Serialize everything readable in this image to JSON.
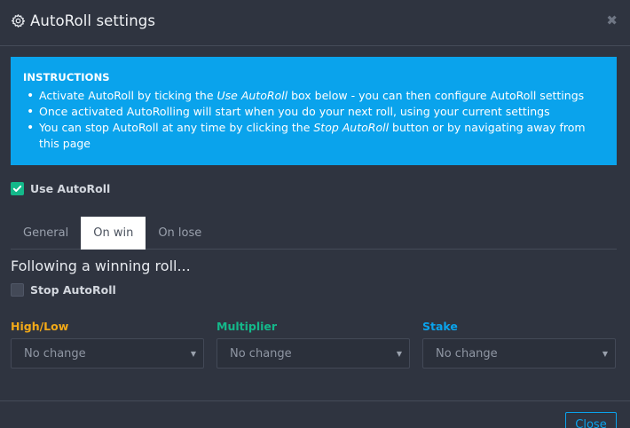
{
  "header": {
    "title": "AutoRoll settings",
    "icon": "gear-icon",
    "close_icon": "close-icon"
  },
  "instructions": {
    "heading": "INSTRUCTIONS",
    "items": [
      {
        "before": "Activate AutoRoll by ticking the ",
        "em": "Use AutoRoll",
        "after": " box below - you can then configure AutoRoll settings"
      },
      {
        "before": "Once activated AutoRolling will start when you do your next roll, using your current settings",
        "em": "",
        "after": ""
      },
      {
        "before": "You can stop AutoRoll at any time by clicking the ",
        "em": "Stop AutoRoll",
        "after": " button or by navigating away from this page"
      }
    ],
    "color": "#0aa3ec"
  },
  "use_autoroll": {
    "label": "Use AutoRoll",
    "checked": true,
    "color": "#14b88a"
  },
  "tabs": [
    {
      "label": "General",
      "active": false
    },
    {
      "label": "On win",
      "active": true
    },
    {
      "label": "On lose",
      "active": false
    }
  ],
  "section": {
    "heading": "Following a winning roll...",
    "stop_autoroll": {
      "label": "Stop AutoRoll",
      "checked": false
    }
  },
  "fields": [
    {
      "label": "High/Low",
      "value": "No change",
      "color": "#f2a918"
    },
    {
      "label": "Multiplier",
      "value": "No change",
      "color": "#14b88a"
    },
    {
      "label": "Stake",
      "value": "No change",
      "color": "#0aa3ec"
    }
  ],
  "footer": {
    "close_label": "Close"
  }
}
